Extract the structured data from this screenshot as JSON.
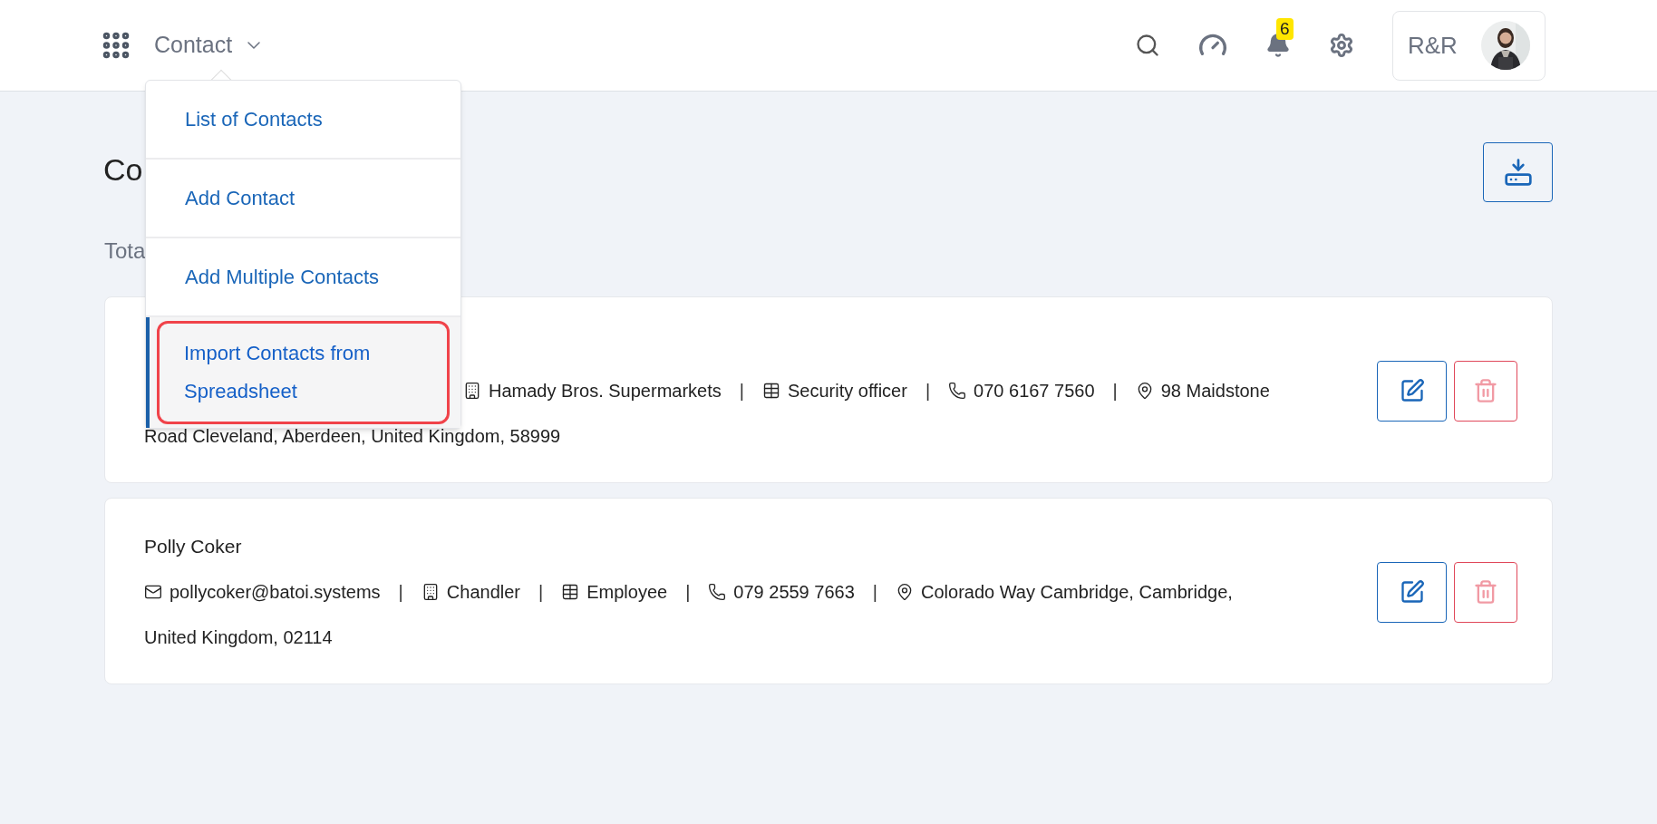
{
  "header": {
    "module": "Contact",
    "notifications": "6",
    "user": "R&R"
  },
  "menu": {
    "items": [
      {
        "label": "List of Contacts",
        "selected": false
      },
      {
        "label": "Add Contact",
        "selected": false
      },
      {
        "label": "Add Multiple Contacts",
        "selected": false
      },
      {
        "label": "Import Contacts from Spreadsheet",
        "selected": true
      }
    ]
  },
  "page": {
    "title": "Co",
    "total": "Tota"
  },
  "contacts": [
    {
      "company": "Hamady Bros. Supermarkets",
      "job": "Security officer",
      "phone": "070 6167 7560",
      "separators": [
        "|",
        "|",
        "|"
      ],
      "address": [
        "98 Maidstone",
        "Road Cleveland, Aberdeen, United Kingdom, 58999"
      ]
    },
    {
      "name": "Polly Coker",
      "email": "pollycoker@batoi.systems",
      "company": "Chandler",
      "job": "Employee",
      "phone": "079 2559 7663",
      "separators": [
        "|",
        "|",
        "|",
        "|"
      ],
      "address": [
        "Colorado Way Cambridge, Cambridge,",
        "United Kingdom, 02114"
      ]
    }
  ]
}
